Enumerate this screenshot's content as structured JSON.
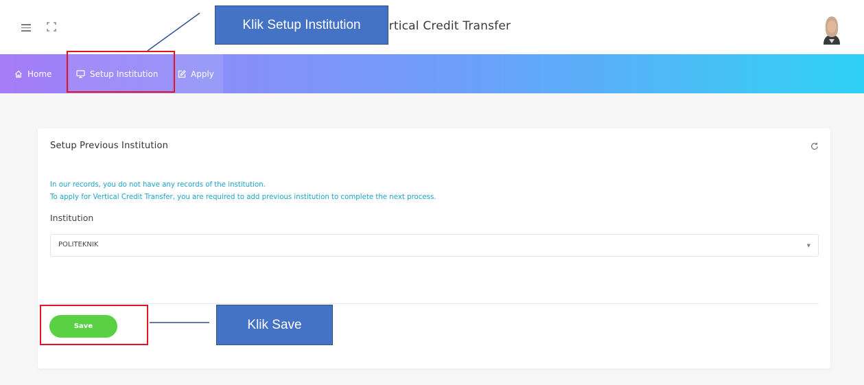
{
  "header": {
    "app_title": "ertical Credit Transfer"
  },
  "nav": {
    "home_label": "Home",
    "setup_label": "Setup Institution",
    "apply_label": "Apply"
  },
  "card": {
    "title": "Setup Previous Institution",
    "info_line1": "In our records, you do not have any records of the institution.",
    "info_line2": "To apply for Vertical Credit Transfer, you are required to add previous institution to complete the next process.",
    "institution_label": "Institution",
    "institution_value": "POLITEKNIK",
    "save_label": "Save"
  },
  "annotations": {
    "setup_callout": "Klik Setup Institution",
    "save_callout": "Klik Save"
  },
  "colors": {
    "accent_gradient_start": "#a57cf7",
    "accent_gradient_end": "#2dd0f4",
    "info_text": "#1fa3c7",
    "save_button": "#5ad045",
    "callout_fill": "#4472c4",
    "highlight_border": "#e3141f"
  },
  "icons": [
    "menu-icon",
    "fullscreen-icon",
    "home-icon",
    "monitor-icon",
    "edit-icon",
    "refresh-icon",
    "dropdown-caret-icon"
  ]
}
